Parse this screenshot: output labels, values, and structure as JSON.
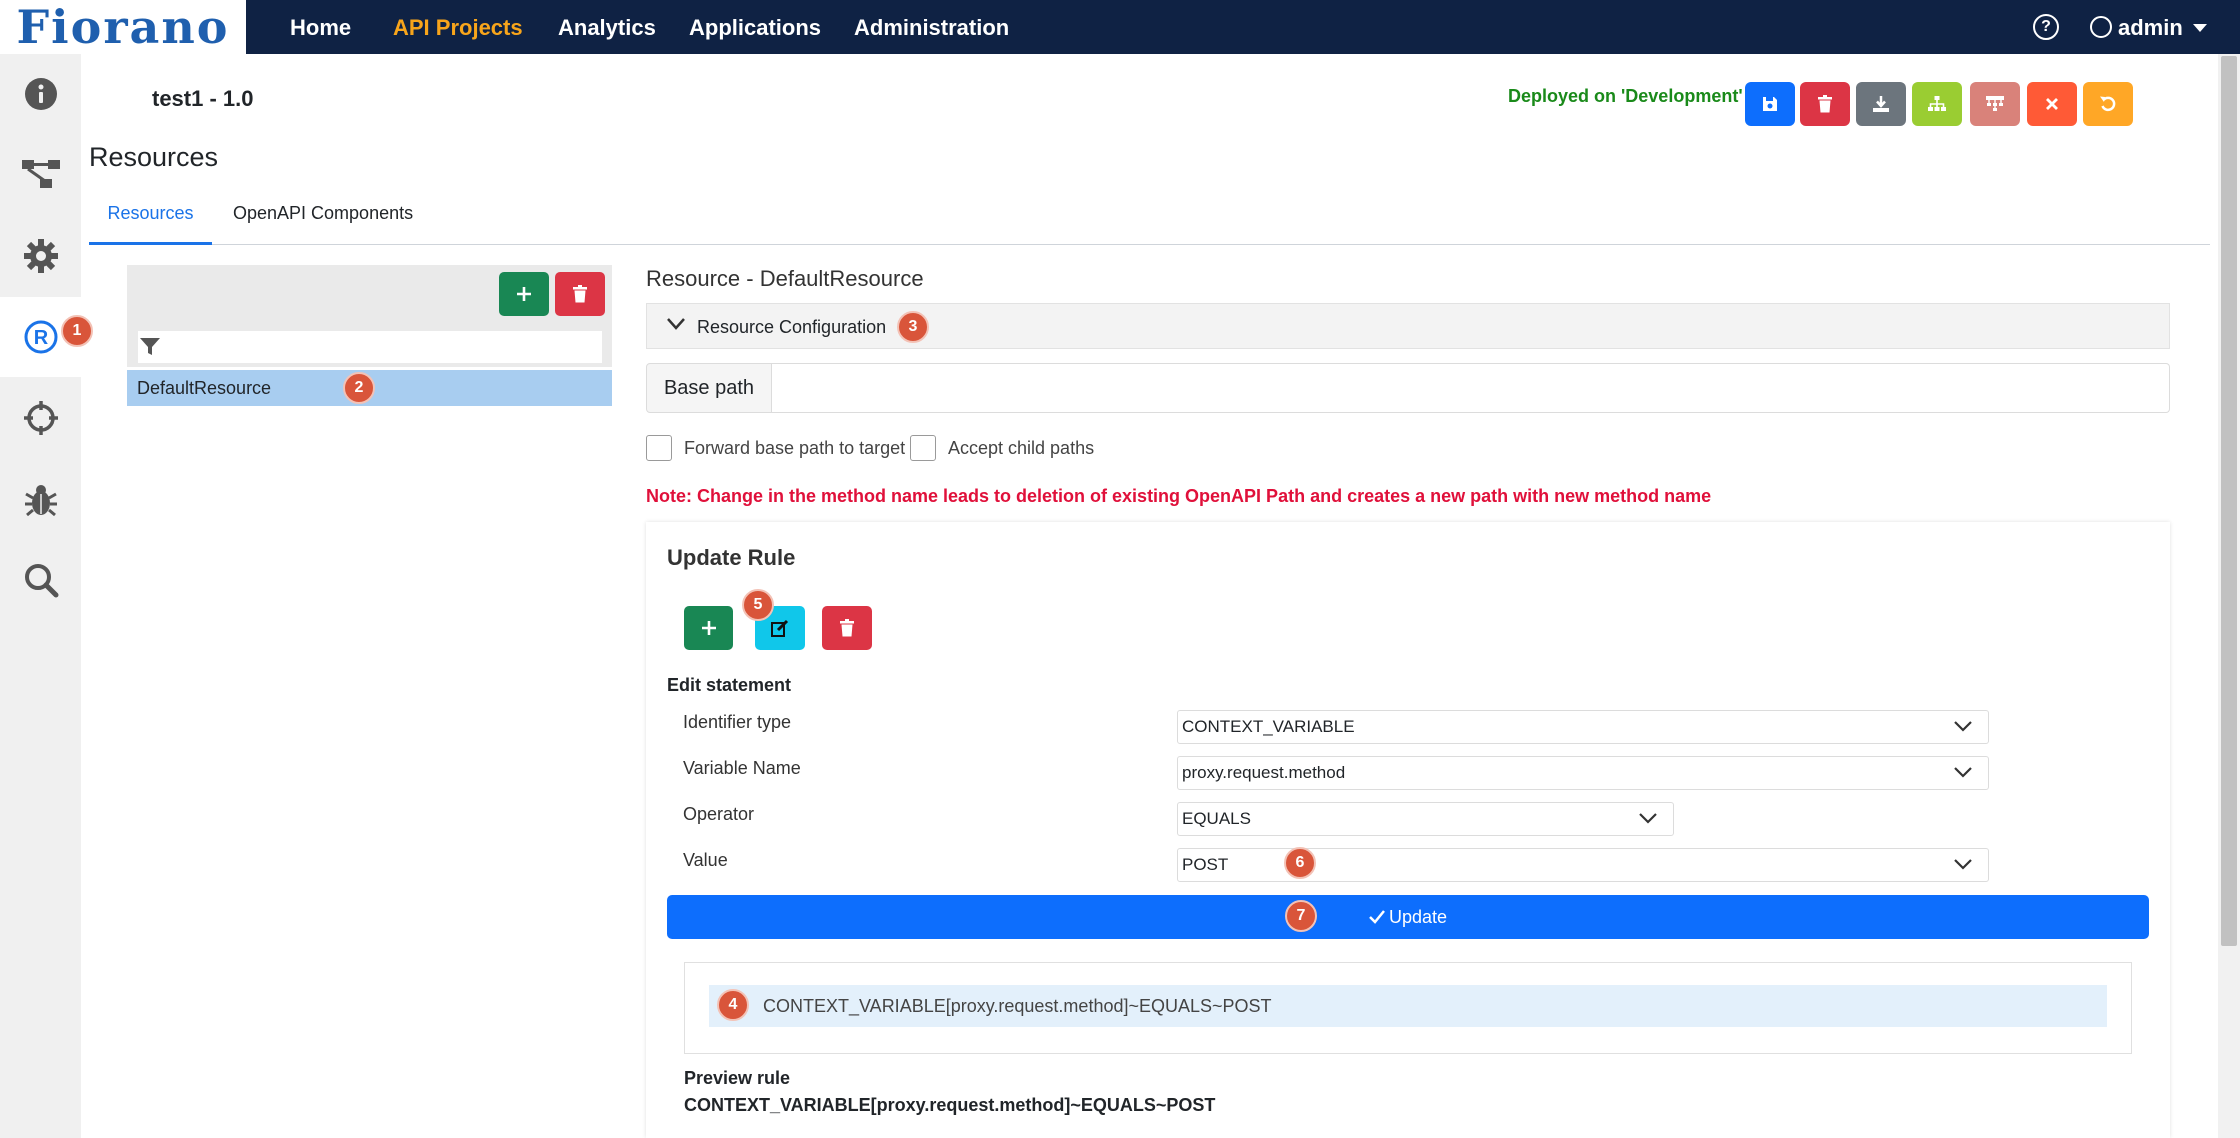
{
  "navbar": {
    "logo": "Fiorano",
    "items": [
      "Home",
      "API Projects",
      "Analytics",
      "Applications",
      "Administration"
    ],
    "help": "?",
    "user": "admin"
  },
  "sidebar": {
    "icons": [
      "info-icon",
      "flow-icon",
      "gear-icon",
      "resource-icon",
      "crosshair-icon",
      "bug-icon",
      "search-icon"
    ]
  },
  "project": {
    "title": "test1 - 1.0",
    "status": "Deployed on 'Development'"
  },
  "toolbar": {
    "colors": {
      "save": "#0d6efd",
      "delete": "#dc3545",
      "download": "#6c757d",
      "deploy": "#9acd32",
      "hierarchy": "#d9827a",
      "close": "#ff5a36",
      "undo": "#ffa726"
    }
  },
  "page": {
    "title": "Resources",
    "tabs": [
      "Resources",
      "OpenAPI Components"
    ]
  },
  "resources": {
    "filter_placeholder": "",
    "items": [
      "DefaultResource"
    ]
  },
  "resource": {
    "heading": "Resource - DefaultResource",
    "config_label": "Resource Configuration",
    "basepath_label": "Base path",
    "basepath_value": "",
    "forward_label": "Forward base path to target",
    "child_label": "Accept child paths",
    "note": "Note: Change in the method name leads to deletion of existing OpenAPI Path and creates a new path with new method name"
  },
  "rule": {
    "title": "Update Rule",
    "edit_label": "Edit statement",
    "fields": {
      "identifier_label": "Identifier type",
      "identifier_value": "CONTEXT_VARIABLE",
      "variable_label": "Variable Name",
      "variable_value": "proxy.request.method",
      "operator_label": "Operator",
      "operator_value": "EQUALS",
      "value_label": "Value",
      "value_value": "POST"
    },
    "update_label": "Update",
    "statement": "CONTEXT_VARIABLE[proxy.request.method]~EQUALS~POST",
    "preview_label": "Preview rule",
    "preview_value": "CONTEXT_VARIABLE[proxy.request.method]~EQUALS~POST"
  },
  "annotations": [
    "1",
    "2",
    "3",
    "4",
    "5",
    "6",
    "7"
  ]
}
